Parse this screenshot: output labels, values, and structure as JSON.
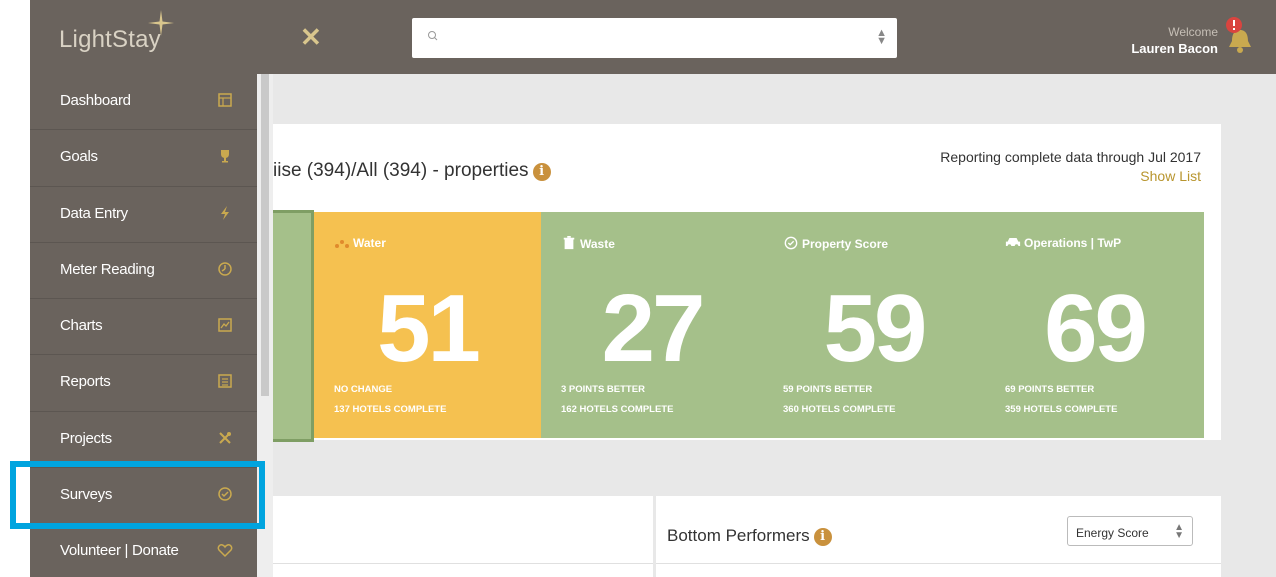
{
  "header": {
    "logo": "LightStay",
    "welcome": "Welcome",
    "user_name": "Lauren Bacon",
    "search_placeholder": ""
  },
  "sidebar": {
    "items": [
      {
        "label": "Dashboard",
        "icon": "dashboard-icon"
      },
      {
        "label": "Goals",
        "icon": "trophy-icon"
      },
      {
        "label": "Data Entry",
        "icon": "lightning-icon"
      },
      {
        "label": "Meter Reading",
        "icon": "gauge-icon"
      },
      {
        "label": "Charts",
        "icon": "chart-icon"
      },
      {
        "label": "Reports",
        "icon": "report-icon"
      },
      {
        "label": "Projects",
        "icon": "tools-icon"
      },
      {
        "label": "Surveys",
        "icon": "check-circle-icon"
      },
      {
        "label": "Volunteer | Donate",
        "icon": "heart-icon"
      }
    ]
  },
  "main": {
    "title": "iise (394)/All (394) - properties",
    "reporting": "Reporting complete data through Jul 2017",
    "show_list": "Show List",
    "metrics": [
      {
        "title": "Water",
        "value": "51",
        "change": "NO CHANGE",
        "complete": "137 HOTELS COMPLETE",
        "icon": "water-drops-icon"
      },
      {
        "title": "Waste",
        "value": "27",
        "change": "3 POINTS BETTER",
        "complete": "162 HOTELS COMPLETE",
        "icon": "trash-icon"
      },
      {
        "title": "Property Score",
        "value": "59",
        "change": "59 POINTS BETTER",
        "complete": "360 HOTELS COMPLETE",
        "icon": "check-circle-icon"
      },
      {
        "title": "Operations | TwP",
        "value": "69",
        "change": "69 POINTS BETTER",
        "complete": "359 HOTELS COMPLETE",
        "icon": "car-icon"
      }
    ],
    "bottom": {
      "title": "Bottom Performers",
      "select_value": "Energy Score"
    }
  },
  "colors": {
    "header_bg": "#6a635d",
    "water_tile": "#f5c150",
    "green_tile": "#a5c08a",
    "accent_gold": "#c9a94f",
    "highlight": "#00a4df"
  }
}
